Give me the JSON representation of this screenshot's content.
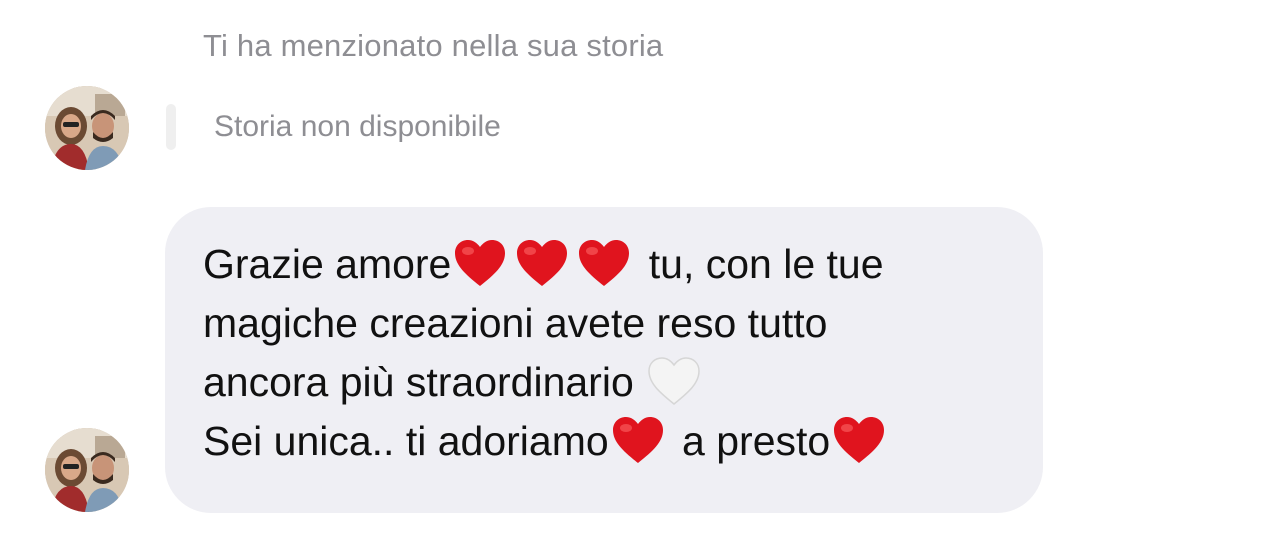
{
  "thread": {
    "mention_caption": "Ti ha menzionato nella sua storia",
    "story_unavailable_label": "Storia non disponibile",
    "message": {
      "line1_before": "Grazie amore",
      "line1_after": " tu, con le tue",
      "line2": "magiche creazioni avete reso tutto",
      "line3": "ancora più straordinario ",
      "line4_before": "Sei unica.. ti adoriamo",
      "line4_middle": " a presto"
    }
  },
  "colors": {
    "bubble_background": "#efeff4",
    "caption_gray": "#8e8e93",
    "red_heart": "#e0141e",
    "white_heart": "#eeeeee"
  },
  "icons": {
    "red_heart": "red-heart-emoji",
    "white_heart": "white-heart-emoji",
    "avatar": "contact-avatar-photo"
  }
}
